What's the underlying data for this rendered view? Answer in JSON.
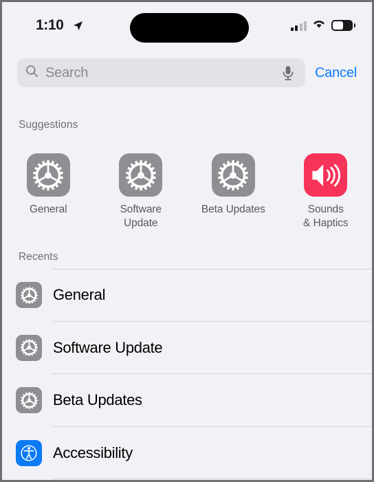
{
  "colors": {
    "page_background": "#f2f1f6",
    "search_field": "#e3e2e7",
    "accent_blue": "#0a7cff",
    "gear_gray": "#8e8e93",
    "sounds_red": "#f8335a",
    "accessibility_blue": "#0b7bf5",
    "separator": "#d4d3d8",
    "secondary_text": "#6f6f76"
  },
  "status_bar": {
    "time": "1:10",
    "location_icon": "location-arrow-icon",
    "cellular_icon": "signal-bars-icon",
    "wifi_icon": "wifi-icon",
    "battery_icon": "battery-icon",
    "dynamic_island": "dynamic-island"
  },
  "search": {
    "placeholder": "Search",
    "value": "",
    "search_icon": "search-icon",
    "dictate_icon": "microphone-icon",
    "cancel_label": "Cancel"
  },
  "suggestions": {
    "header": "Suggestions",
    "items": [
      {
        "label": "General",
        "icon": "gear-icon",
        "color": "#8e8e93"
      },
      {
        "label": "Software\nUpdate",
        "icon": "gear-icon",
        "color": "#8e8e93"
      },
      {
        "label": "Beta Updates",
        "icon": "gear-icon",
        "color": "#8e8e93"
      },
      {
        "label": "Sounds\n& Haptics",
        "icon": "speaker-wave-icon",
        "color": "#f8335a"
      }
    ]
  },
  "recents": {
    "header": "Recents",
    "items": [
      {
        "label": "General",
        "icon": "gear-icon",
        "color": "#8e8e93"
      },
      {
        "label": "Software Update",
        "icon": "gear-icon",
        "color": "#8e8e93"
      },
      {
        "label": "Beta Updates",
        "icon": "gear-icon",
        "color": "#8e8e93"
      },
      {
        "label": "Accessibility",
        "icon": "accessibility-icon",
        "color": "#0b7bf5"
      }
    ]
  }
}
